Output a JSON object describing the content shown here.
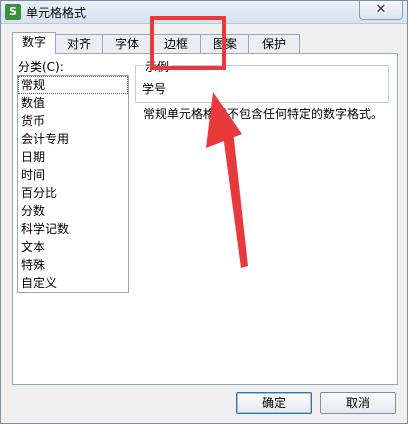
{
  "window": {
    "title": "单元格格式",
    "app_icon_glyph": "S",
    "close_glyph": "✕"
  },
  "tabs": [
    {
      "label": "数字",
      "active": true
    },
    {
      "label": "对齐"
    },
    {
      "label": "字体"
    },
    {
      "label": "边框"
    },
    {
      "label": "图案"
    },
    {
      "label": "保护"
    }
  ],
  "category": {
    "label": "分类(C):",
    "items": [
      "常规",
      "数值",
      "货币",
      "会计专用",
      "日期",
      "时间",
      "百分比",
      "分数",
      "科学记数",
      "文本",
      "特殊",
      "自定义"
    ],
    "selected": "常规"
  },
  "sample": {
    "legend": "示例",
    "value": "学号"
  },
  "description": "常规单元格格式不包含任何特定的数字格式。",
  "buttons": {
    "ok": "确定",
    "cancel": "取消"
  },
  "annotation": {
    "color": "#e8393d"
  }
}
